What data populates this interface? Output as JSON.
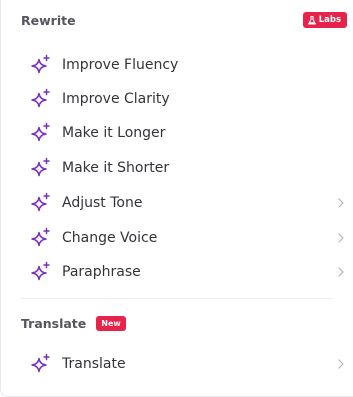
{
  "colors": {
    "accent": "#7b2fbe",
    "badge": "#e5234b",
    "text": "#33333a",
    "header": "#55555f",
    "chevron": "#b4b4bc"
  },
  "rewrite": {
    "title": "Rewrite",
    "badge": "Labs",
    "badge_icon": "flask-icon",
    "items": [
      {
        "label": "Improve Fluency",
        "icon": "sparkle-icon",
        "has_submenu": false
      },
      {
        "label": "Improve Clarity",
        "icon": "sparkle-icon",
        "has_submenu": false
      },
      {
        "label": "Make it Longer",
        "icon": "sparkle-icon",
        "has_submenu": false
      },
      {
        "label": "Make it Shorter",
        "icon": "sparkle-icon",
        "has_submenu": false
      },
      {
        "label": "Adjust Tone",
        "icon": "sparkle-icon",
        "has_submenu": true
      },
      {
        "label": "Change Voice",
        "icon": "sparkle-icon",
        "has_submenu": true
      },
      {
        "label": "Paraphrase",
        "icon": "sparkle-icon",
        "has_submenu": true
      }
    ]
  },
  "translate": {
    "title": "Translate",
    "badge": "New",
    "items": [
      {
        "label": "Translate",
        "icon": "sparkle-icon",
        "has_submenu": true
      }
    ]
  }
}
